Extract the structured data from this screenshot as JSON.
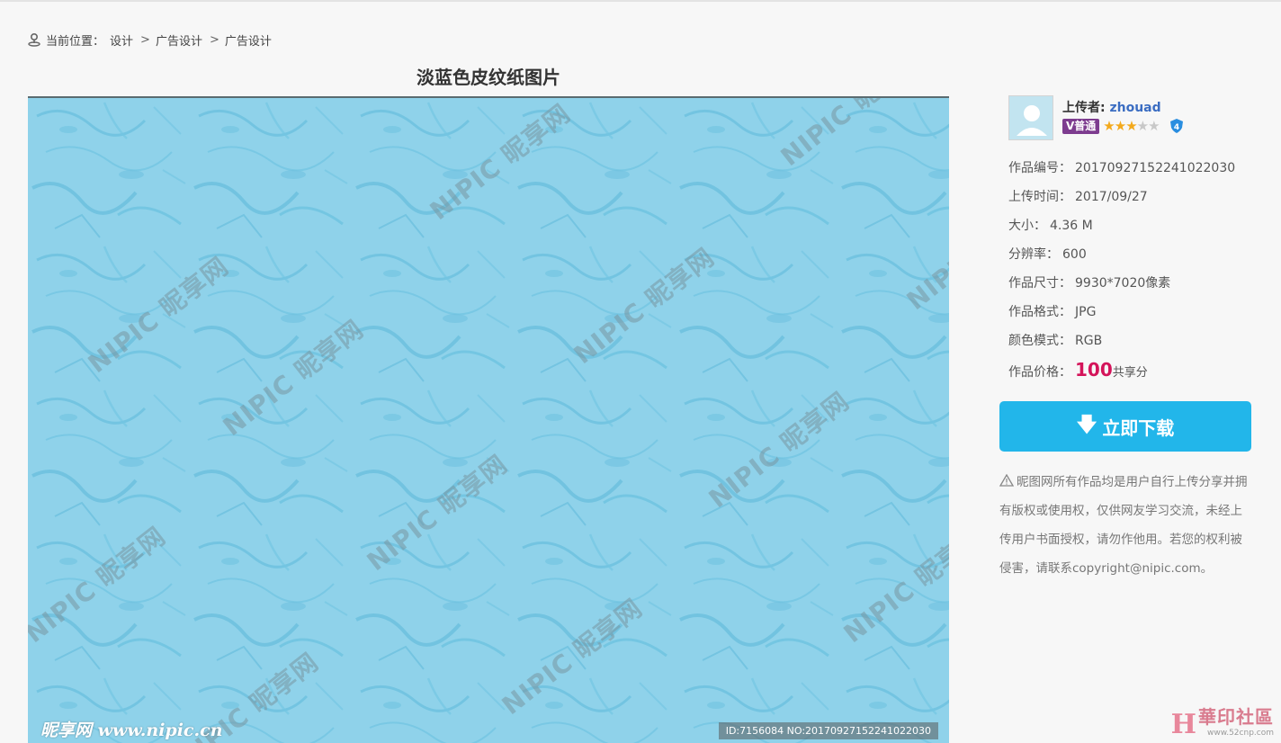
{
  "breadcrumb": {
    "prefix": "当前位置：",
    "items": [
      "设计",
      "广告设计",
      "广告设计"
    ],
    "separator": ">"
  },
  "title": "淡蓝色皮纹纸图片",
  "preview": {
    "watermark": "NIPIC 昵享网",
    "logo": "昵享网 www.nipic.cn",
    "id_strip": "ID:7156084 NO:20170927152241022030",
    "background_color": "#8fd2ea"
  },
  "uploader": {
    "label": "上传者:",
    "name": "zhouad",
    "vip_badge": "V普通",
    "stars_total": 5,
    "stars_on": 3,
    "shield_level": "4"
  },
  "info": [
    {
      "label": "作品编号：",
      "value": "20170927152241022030"
    },
    {
      "label": "上传时间：",
      "value": "2017/09/27"
    },
    {
      "label": "大小：",
      "value": "4.36 M"
    },
    {
      "label": "分辨率：",
      "value": "600"
    },
    {
      "label": "作品尺寸：",
      "value": "9930*7020像素"
    },
    {
      "label": "作品格式：",
      "value": "JPG"
    },
    {
      "label": "颜色模式：",
      "value": "RGB"
    }
  ],
  "price": {
    "label": "作品价格：",
    "value": "100",
    "unit": "共享分"
  },
  "download_label": "立即下载",
  "notice": "昵图网所有作品均是用户自行上传分享并拥有版权或使用权，仅供网友学习交流，未经上传用户书面授权，请勿作他用。若您的权利被侵害，请联系copyright@nipic.com。",
  "site_mark": {
    "logo": "H",
    "name": "華印社區",
    "url": "www.52cnp.com"
  },
  "colors": {
    "accent": "#22b6ea",
    "price": "#d4145a",
    "link": "#3b6dc2"
  }
}
